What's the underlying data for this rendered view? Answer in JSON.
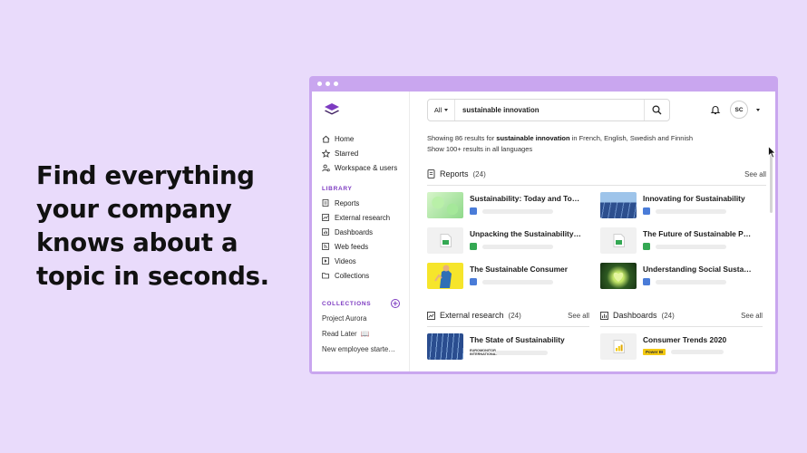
{
  "headline": "Find everything your company knows about a topic in seconds.",
  "colors": {
    "background": "#e9dbfb",
    "window": "#c9a6ef",
    "accent": "#7d3bc1",
    "reports_badge": "#4a7cd8",
    "sheets_badge": "#34a853"
  },
  "nav": [
    {
      "label": "Home",
      "icon": "home-icon"
    },
    {
      "label": "Starred",
      "icon": "star-icon"
    },
    {
      "label": "Workspace & users",
      "icon": "users-icon"
    }
  ],
  "library": {
    "title": "LIBRARY",
    "items": [
      {
        "label": "Reports",
        "icon": "report-icon"
      },
      {
        "label": "External research",
        "icon": "chart-icon"
      },
      {
        "label": "Dashboards",
        "icon": "dashboard-icon"
      },
      {
        "label": "Web feeds",
        "icon": "rss-icon"
      },
      {
        "label": "Videos",
        "icon": "video-icon"
      },
      {
        "label": "Collections",
        "icon": "folder-icon"
      }
    ]
  },
  "collections": {
    "title": "COLLECTIONS",
    "items": [
      "Project Aurora",
      "Read Later",
      "New employee starte…"
    ],
    "book_glyph": "📖"
  },
  "search": {
    "scope": "All",
    "query": "sustainable innovation"
  },
  "avatar": "SC",
  "summary": {
    "prefix": "Showing 86 results for ",
    "query": "sustainable innovation",
    "suffix": " in French, English, Swedish and Finnish",
    "link": "Show 100+ results in all languages"
  },
  "reports": {
    "title": "Reports",
    "count": "(24)",
    "see_all": "See all",
    "items": [
      {
        "title": "Sustainability: Today and To…",
        "thumb": "green-map",
        "badge": "doc"
      },
      {
        "title": "Innovating for Sustainability",
        "thumb": "solar",
        "badge": "doc"
      },
      {
        "title": "Unpacking the Sustainability…",
        "thumb": "sheet",
        "badge": "sheet"
      },
      {
        "title": "The Future of Sustainable P…",
        "thumb": "sheet",
        "badge": "sheet"
      },
      {
        "title": "The Sustainable Consumer",
        "thumb": "yellow",
        "badge": "doc"
      },
      {
        "title": "Understanding Social Susta…",
        "thumb": "heart",
        "badge": "doc"
      }
    ]
  },
  "external": {
    "title": "External research",
    "count": "(24)",
    "see_all": "See all",
    "item": {
      "title": "The State of Sustainability",
      "source": "EUROMONITOR INTERNATIONAL"
    }
  },
  "dashboards": {
    "title": "Dashboards",
    "count": "(24)",
    "see_all": "See all",
    "item": {
      "title": "Consumer Trends 2020",
      "source": "Power BI"
    }
  }
}
